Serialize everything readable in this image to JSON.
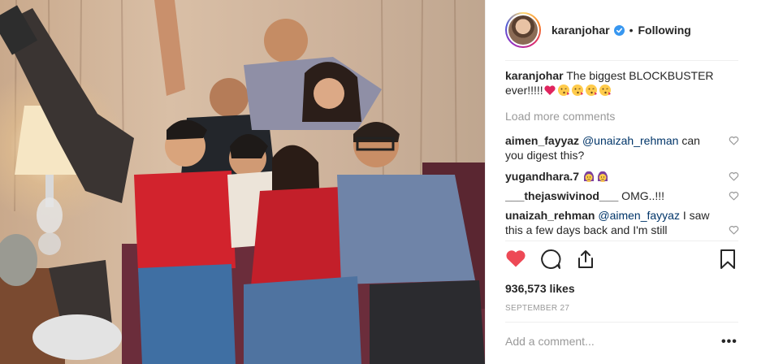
{
  "post": {
    "author": "karanjohar",
    "verified": true,
    "separator": "•",
    "follow_state": "Following",
    "image_alt": "Group photo of eight people posing together on a sofa",
    "caption": {
      "username": "karanjohar",
      "text": "The biggest BLOCKBUSTER ever!!!!!",
      "emojis": [
        "red-heart-emoji",
        "kiss-face-emoji",
        "kiss-face-emoji",
        "kiss-face-emoji",
        "kiss-face-emoji"
      ]
    },
    "load_more": "Load more comments",
    "comments": [
      {
        "username": "aimen_fayyaz",
        "mention": "@unaizah_rehman",
        "text": " can you digest this?"
      },
      {
        "username": "yugandhara.7",
        "mention": "",
        "text": "",
        "emojis": [
          "hands-on-head-emoji",
          "hands-on-head-emoji"
        ]
      },
      {
        "username": "___thejaswivinod___",
        "mention": "",
        "text": " OMG..!!!"
      },
      {
        "username": "unaizah_rehman",
        "mention": "@aimen_fayyaz",
        "text": " I saw this a few days back and I'm still screaming if this is happening any"
      }
    ],
    "likes": "936,573 likes",
    "date": "SEPTEMBER 27",
    "add_comment_placeholder": "Add a comment...",
    "more_options": "•••",
    "colors": {
      "like_red": "#ed4956",
      "verified_blue": "#3897f0",
      "mention_blue": "#003569",
      "muted_gray": "#999999",
      "text": "#262626"
    },
    "icons": {
      "like": "heart-icon",
      "comment": "comment-bubble-icon",
      "share": "share-icon",
      "save": "bookmark-icon",
      "comment_like": "heart-outline-icon"
    }
  }
}
